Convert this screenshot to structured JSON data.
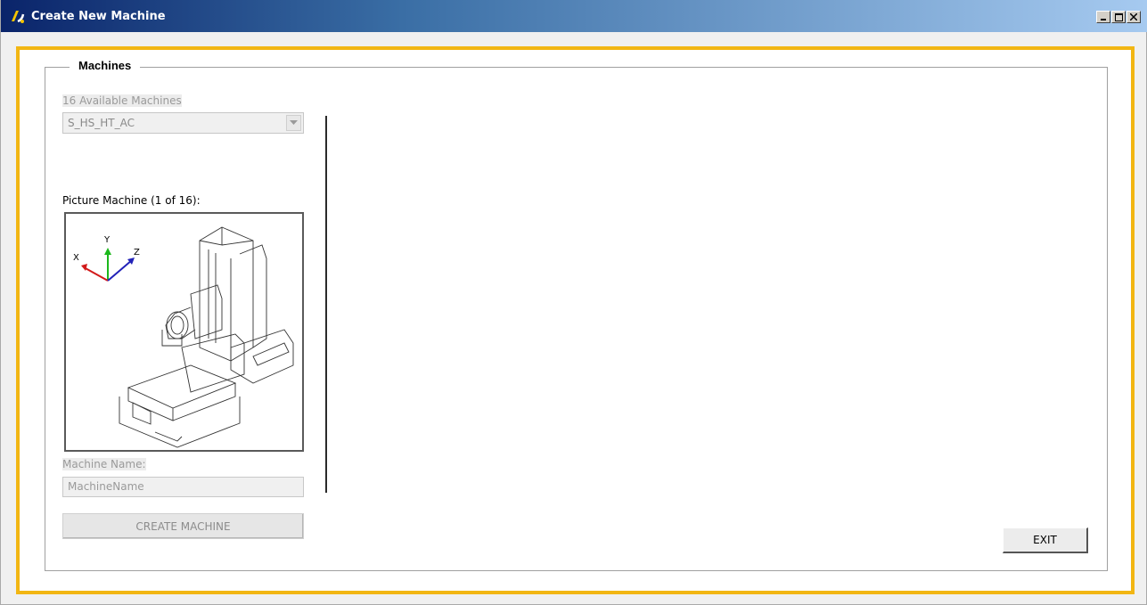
{
  "window": {
    "title": "Create New Machine",
    "controls": [
      "minimize-icon",
      "maximize-icon",
      "close-icon"
    ]
  },
  "group": {
    "legend": "Machines"
  },
  "machines": {
    "available_label": "16 Available Machines",
    "selected": "S_HS_HT_AC",
    "picture_label": "Picture Machine (1 of 16):",
    "axes": {
      "x": "X",
      "y": "Y",
      "z": "Z"
    },
    "name_label": "Machine Name:",
    "name_placeholder": "MachineName",
    "create_label": "CREATE MACHINE"
  },
  "footer": {
    "exit_label": "EXIT"
  },
  "colors": {
    "frame_accent": "#f2b613",
    "titlebar_start": "#0a246a",
    "titlebar_end": "#a6caf0"
  }
}
